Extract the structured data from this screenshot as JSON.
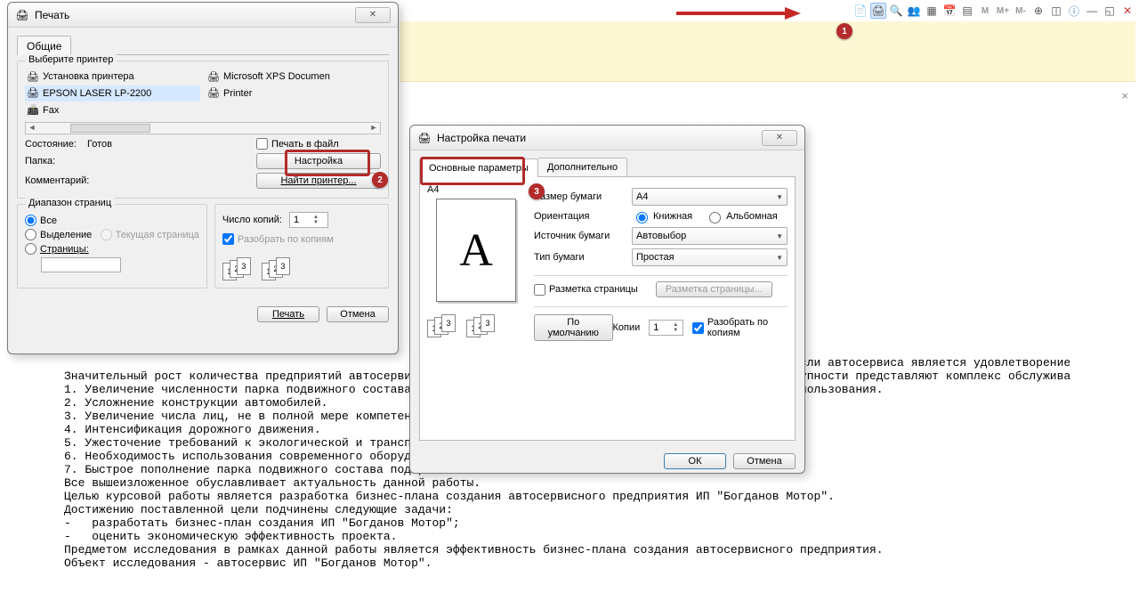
{
  "toolbar": {
    "icons": [
      "doc-icon",
      "print-icon",
      "search-icon",
      "users-icon",
      "table-icon",
      "calendar-icon",
      "grid-icon",
      "m-icon",
      "m-plus-icon",
      "m-minus-icon",
      "zoom-in-icon",
      "split-icon",
      "help-icon",
      "min-icon",
      "restore-icon",
      "close-icon"
    ]
  },
  "badges": {
    "b1": "1",
    "b2": "2",
    "b3": "3"
  },
  "print_dialog": {
    "title": "Печать",
    "tab_general": "Общие",
    "group_select_printer": "Выберите принтер",
    "printers": [
      {
        "icon": "🖨",
        "label": "Установка принтера"
      },
      {
        "icon": "🖨",
        "label": "Microsoft XPS Documen"
      },
      {
        "icon": "🖨",
        "label": "EPSON LASER LP-2200",
        "selected": true
      },
      {
        "icon": "🖨",
        "label": "Printer"
      },
      {
        "icon": "📠",
        "label": "Fax"
      }
    ],
    "status_label": "Состояние:",
    "status_value": "Готов",
    "folder_label": "Папка:",
    "comment_label": "Комментарий:",
    "print_to_file": "Печать в файл",
    "settings_btn": "Настройка",
    "find_printer_btn": "Найти принтер...",
    "range_group": "Диапазон страниц",
    "range_all": "Все",
    "range_current": "Текущая страница",
    "range_selection": "Выделение",
    "range_pages": "Страницы:",
    "copies_label": "Число копий:",
    "copies_value": "1",
    "collate": "Разобрать по копиям",
    "print_btn": "Печать",
    "cancel_btn": "Отмена"
  },
  "setup_dialog": {
    "title": "Настройка печати",
    "tab_main": "Основные параметры",
    "tab_extra": "Дополнительно",
    "preview_label": "A4",
    "preview_letter": "A",
    "paper_size_label": "Размер бумаги",
    "paper_size_value": "A4",
    "orientation_label": "Ориентация",
    "orient_portrait": "Книжная",
    "orient_landscape": "Альбомная",
    "source_label": "Источник бумаги",
    "source_value": "Автовыбор",
    "paper_type_label": "Тип бумаги",
    "paper_type_value": "Простая",
    "layout_chk": "Разметка страницы",
    "layout_btn": "Разметка страницы...",
    "default_btn": "По умолчанию",
    "copies_label": "Копии",
    "copies_value": "1",
    "collate": "Разобрать по копиям",
    "ok_btn": "ОК",
    "cancel_btn": "Отмена"
  },
  "document_text": "                                                                                                  ием отрасли автосервиса является удовлетворение\nЗначительный рост количества предприятий автосерви                                               е в совокупности представляют комплекс обслужива\n1. Увеличение численности парка подвижного состава,                                               ального пользования.\n2. Усложнение конструкции автомобилей.\n3. Увеличение числа лиц, не в полной мере компетентн\n4. Интенсификация дорожного движения.\n5. Ужесточение требований к экологической и транспор\n6. Необходимость использования современного оборудо                                              .\n7. Быстрое пополнение парка подвижного состава подер\nВсе вышеизложенное обуславливает актуальность данной работы.\nЦелью курсовой работы является разработка бизнес-плана создания автосервисного предприятия ИП \"Богданов Мотор\".\nДостижению поставленной цели подчинены следующие задачи:\n-   разработать бизнес-план создания ИП \"Богданов Мотор\";\n-   оценить экономическую эффективность проекта.\nПредметом исследования в рамках данной работы является эффективность бизнес-плана создания автосервисного предприятия.\nОбъект исследования - автосервис ИП \"Богданов Мотор\"."
}
